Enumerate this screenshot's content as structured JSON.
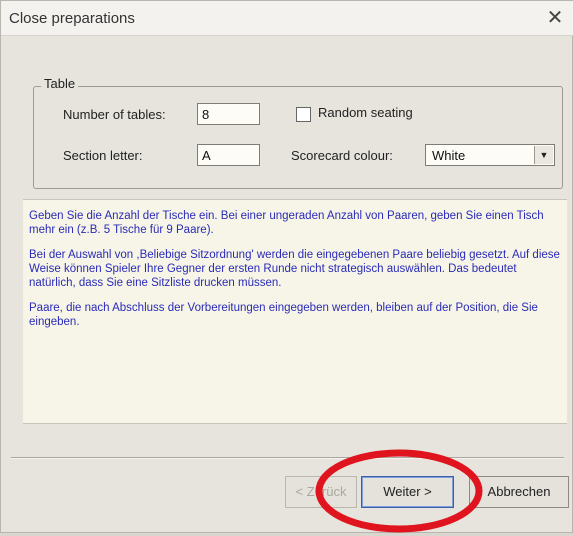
{
  "window": {
    "title": "Close preparations",
    "close_glyph": "✕"
  },
  "table_group": {
    "legend": "Table",
    "number_of_tables_label": "Number of tables:",
    "number_of_tables_value": "8",
    "random_seating_label": "Random seating",
    "random_seating_checked": false,
    "section_letter_label": "Section letter:",
    "section_letter_value": "A",
    "scorecard_colour_label": "Scorecard colour:",
    "scorecard_colour_value": "White"
  },
  "info": {
    "paragraphs": [
      "Geben Sie die Anzahl der Tische ein. Bei einer ungeraden Anzahl von Paaren, geben Sie einen Tisch mehr ein (z.B. 5 Tische für 9 Paare).",
      "Bei der Auswahl von ,Beliebige Sitzordnung' werden die eingegebenen Paare beliebig gesetzt. Auf diese Weise können Spieler Ihre Gegner der ersten Runde nicht strategisch auswählen. Das bedeutet natürlich, dass Sie eine Sitzliste drucken müssen.",
      "Paare, die nach Abschluss der Vorbereitungen eingegeben werden, bleiben auf der Position, die Sie eingeben."
    ],
    "text_color": "#2b2bb8"
  },
  "buttons": {
    "back_label": "< Zurück",
    "next_label": "Weiter >",
    "cancel_label": "Abbrechen"
  },
  "annotation": {
    "circle_color": "#e0141e"
  }
}
